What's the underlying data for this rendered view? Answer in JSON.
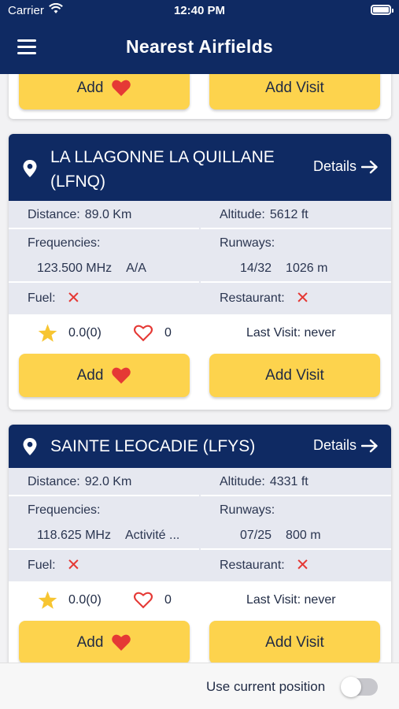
{
  "status": {
    "carrier": "Carrier",
    "time": "12:40 PM"
  },
  "header": {
    "title": "Nearest Airfields"
  },
  "partial_card": {
    "add_label": "Add",
    "visit_label": "Add Visit"
  },
  "cards": [
    {
      "name": "LA LLAGONNE LA QUILLANE (LFNQ)",
      "details": "Details",
      "distance_label": "Distance:",
      "distance": "89.0 Km",
      "altitude_label": "Altitude:",
      "altitude": "5612 ft",
      "frequencies_label": "Frequencies:",
      "frequency": "123.500 MHz",
      "frequency_name": "A/A",
      "runways_label": "Runways:",
      "runway": "14/32",
      "runway_length": "1026 m",
      "fuel_label": "Fuel:",
      "restaurant_label": "Restaurant:",
      "rating": "0.0",
      "rating_count": "(0)",
      "likes": "0",
      "last_visit_label": "Last Visit:",
      "last_visit": "never",
      "add_label": "Add",
      "visit_label": "Add Visit"
    },
    {
      "name": "SAINTE LEOCADIE (LFYS)",
      "details": "Details",
      "distance_label": "Distance:",
      "distance": "92.0 Km",
      "altitude_label": "Altitude:",
      "altitude": "4331 ft",
      "frequencies_label": "Frequencies:",
      "frequency": "118.625 MHz",
      "frequency_name": "Activité ...",
      "runways_label": "Runways:",
      "runway": "07/25",
      "runway_length": "800 m",
      "fuel_label": "Fuel:",
      "restaurant_label": "Restaurant:",
      "rating": "0.0",
      "rating_count": "(0)",
      "likes": "0",
      "last_visit_label": "Last Visit:",
      "last_visit": "never",
      "add_label": "Add",
      "visit_label": "Add Visit"
    }
  ],
  "bottom": {
    "use_position_label": "Use current position",
    "use_position_on": false
  },
  "colors": {
    "navy": "#0f2a63",
    "button_yellow": "#fdd34d",
    "red": "#e53935",
    "star_yellow": "#f7c531"
  }
}
